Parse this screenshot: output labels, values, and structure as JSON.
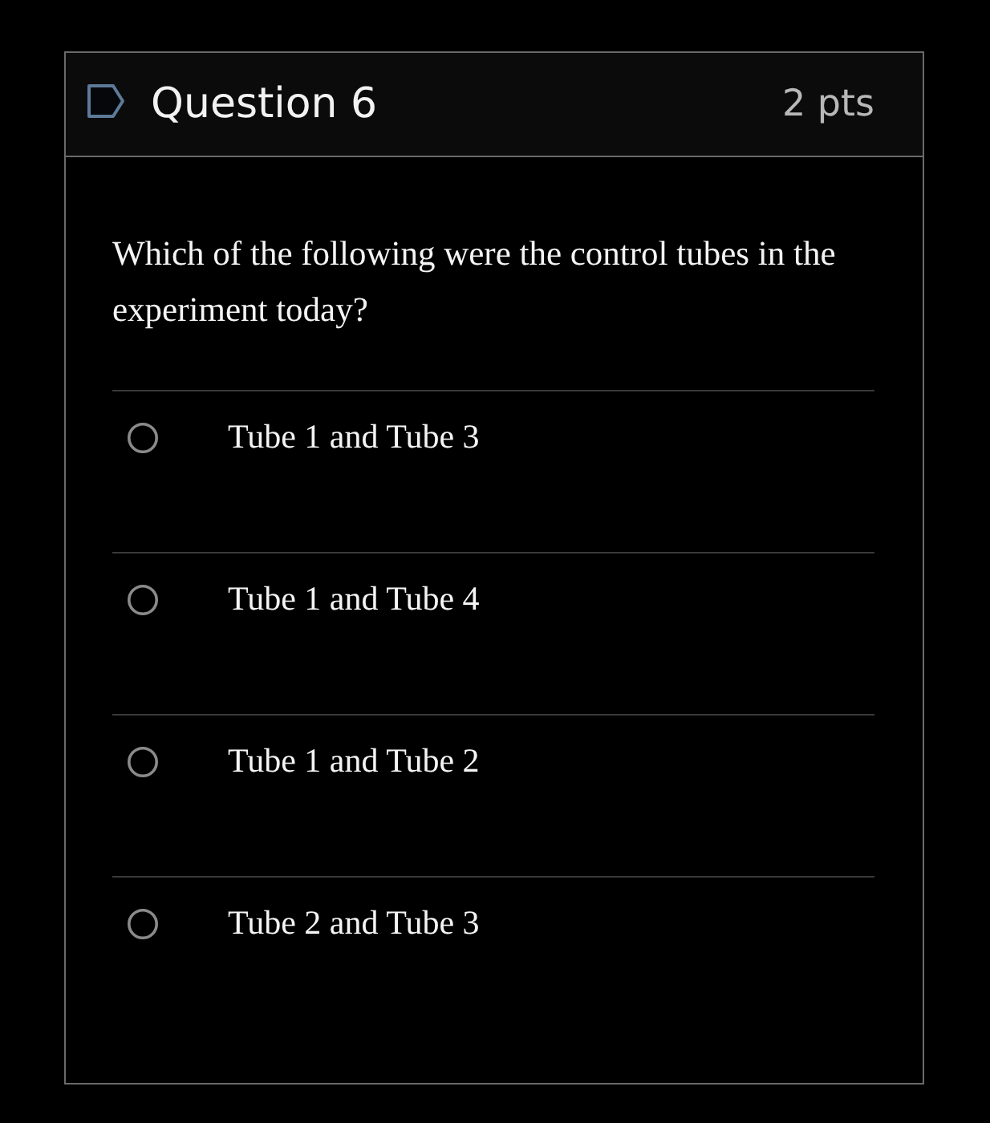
{
  "question": {
    "title": "Question 6",
    "points": "2 pts",
    "text": "Which of the following were the control tubes in the experiment today?"
  },
  "answers": [
    {
      "label": "Tube 1 and Tube 3",
      "selected": false
    },
    {
      "label": "Tube 1 and Tube 4",
      "selected": false
    },
    {
      "label": "Tube 1 and Tube 2",
      "selected": false
    },
    {
      "label": "Tube 2 and Tube 3",
      "selected": false
    }
  ]
}
